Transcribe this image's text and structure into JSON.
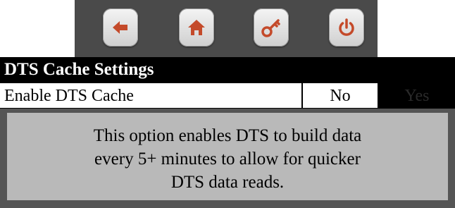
{
  "nav": {
    "buttons": [
      {
        "name": "back",
        "icon": "arrow-left-icon"
      },
      {
        "name": "home",
        "icon": "home-icon"
      },
      {
        "name": "key",
        "icon": "key-icon"
      },
      {
        "name": "power",
        "icon": "power-icon"
      }
    ],
    "icon_color": "#c44a2a"
  },
  "header": {
    "title": "DTS Cache Settings"
  },
  "setting": {
    "label": "Enable DTS Cache",
    "options": [
      "No",
      "Yes"
    ],
    "selected": "No"
  },
  "description": {
    "lines": [
      "This option enables DTS to build data",
      "every 5+ minutes to allow for quicker",
      "DTS data reads."
    ]
  }
}
